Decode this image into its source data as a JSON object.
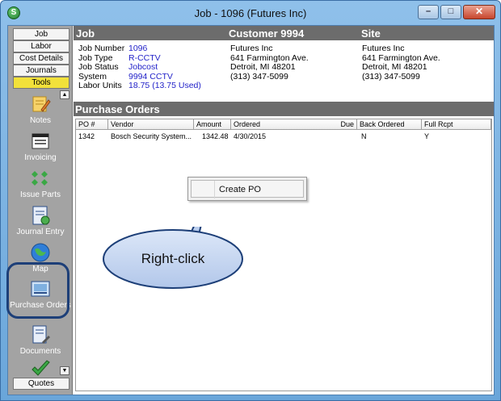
{
  "window": {
    "title": "Job - 1096 (Futures  Inc)",
    "app_icon_letter": "S",
    "minimize_glyph": "–",
    "maximize_glyph": "□",
    "close_glyph": "✕"
  },
  "sidebar": {
    "tabs": [
      {
        "label": "Job"
      },
      {
        "label": "Labor"
      },
      {
        "label": "Cost Details"
      },
      {
        "label": "Journals"
      },
      {
        "label": "Tools",
        "active": true
      }
    ],
    "tools": [
      {
        "label": "Notes",
        "icon": "notes-icon"
      },
      {
        "label": "Invoicing",
        "icon": "invoicing-icon"
      },
      {
        "label": "Issue Parts",
        "icon": "issue-parts-icon"
      },
      {
        "label": "Journal Entry",
        "icon": "journal-entry-icon"
      },
      {
        "label": "Map",
        "icon": "map-icon"
      },
      {
        "label": "Purchase Orders",
        "icon": "purchase-orders-icon"
      },
      {
        "label": "Documents",
        "icon": "documents-icon"
      },
      {
        "label": "",
        "icon": "checkmark-icon"
      }
    ],
    "scroll_up_glyph": "▲",
    "scroll_down_glyph": "▼",
    "quotes_label": "Quotes"
  },
  "header": {
    "job_title": "Job",
    "customer_title": "Customer 9994",
    "site_title": "Site"
  },
  "job": {
    "number_label": "Job Number",
    "number": "1096",
    "type_label": "Job Type",
    "type": "R-CCTV",
    "status_label": "Job Status",
    "status": "Jobcost",
    "system_label": "System",
    "system": "9994 CCTV",
    "labor_label": "Labor Units",
    "labor": "18.75 (13.75 Used)"
  },
  "customer": {
    "name": "Futures  Inc",
    "address1": "641 Farmington Ave.",
    "address2": "Detroit, MI  48201",
    "phone": "(313) 347-5099"
  },
  "site": {
    "name": "Futures  Inc",
    "address1": "641 Farmington Ave.",
    "address2": "Detroit, MI  48201",
    "phone": "(313) 347-5099"
  },
  "purchase_orders": {
    "title": "Purchase Orders",
    "columns": [
      "PO #",
      "Vendor",
      "Amount",
      "Ordered",
      "Due",
      "Back Ordered",
      "Full Rcpt"
    ],
    "rows": [
      {
        "po": "1342",
        "vendor": "Bosch Security System...",
        "amount": "1342.48",
        "ordered": "4/30/2015",
        "due": "",
        "back_ordered": "N",
        "full_rcpt": "Y"
      }
    ]
  },
  "context_menu": {
    "item": "Create PO"
  },
  "callout": {
    "text": "Right-click"
  },
  "colors": {
    "active_tab": "#f2e13a",
    "value_text": "#1f1fc8",
    "band": "#6c6c6c",
    "callout_fill": "#c5d6f2",
    "callout_stroke": "#1d3f78"
  }
}
